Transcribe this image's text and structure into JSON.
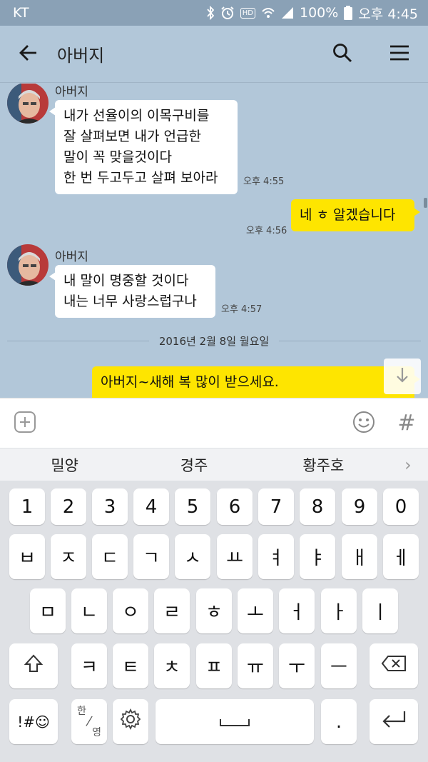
{
  "status_bar": {
    "carrier": "KT",
    "battery": "100%",
    "time": "오후 4:45"
  },
  "header": {
    "title": "아버지",
    "back_icon": "arrow-left-icon",
    "search_icon": "search-icon",
    "menu_icon": "hamburger-menu-icon"
  },
  "messages": [
    {
      "sender": "아버지",
      "text": "내가 선율이의 이목구비를\n잘 살펴보면 내가 언급한\n말이 꼭 맞을것이다\n한 번 두고두고 살펴 보아라",
      "time": "오후 4:55"
    },
    {
      "from_me": true,
      "text": "네 ㅎ 알겠습니다",
      "time": "오후 4:56"
    },
    {
      "sender": "아버지",
      "text": "내 말이 명중할 것이다\n내는 너무 사랑스럽구나",
      "time": "오후 4:57"
    },
    {
      "from_me": true,
      "text": "아버지~새해 복 많이 받으세요."
    }
  ],
  "date_divider": "2016년 2월 8일 월요일",
  "input_bar": {
    "plus_icon": "plus-box-icon",
    "emoji_icon": "smiley-icon",
    "hash_label": "#"
  },
  "suggestions": [
    "밀양",
    "경주",
    "황주호"
  ],
  "keyboard": {
    "row_numbers": [
      "1",
      "2",
      "3",
      "4",
      "5",
      "6",
      "7",
      "8",
      "9",
      "0"
    ],
    "row1": [
      "ㅂ",
      "ㅈ",
      "ㄷ",
      "ㄱ",
      "ㅅ",
      "ㅛ",
      "ㅕ",
      "ㅑ",
      "ㅐ",
      "ㅔ"
    ],
    "row2": [
      "ㅁ",
      "ㄴ",
      "ㅇ",
      "ㄹ",
      "ㅎ",
      "ㅗ",
      "ㅓ",
      "ㅏ",
      "ㅣ"
    ],
    "row3": [
      "ㅋ",
      "ㅌ",
      "ㅊ",
      "ㅍ",
      "ㅠ",
      "ㅜ",
      "ㅡ"
    ],
    "symbols_label": "!#☺",
    "lang_top": "한",
    "lang_bottom": "영",
    "period": "."
  },
  "colors": {
    "chat_bg": "#b2c7d9",
    "my_bubble": "#fee500",
    "other_bubble": "#ffffff",
    "status_bar": "#8aa1b6"
  }
}
